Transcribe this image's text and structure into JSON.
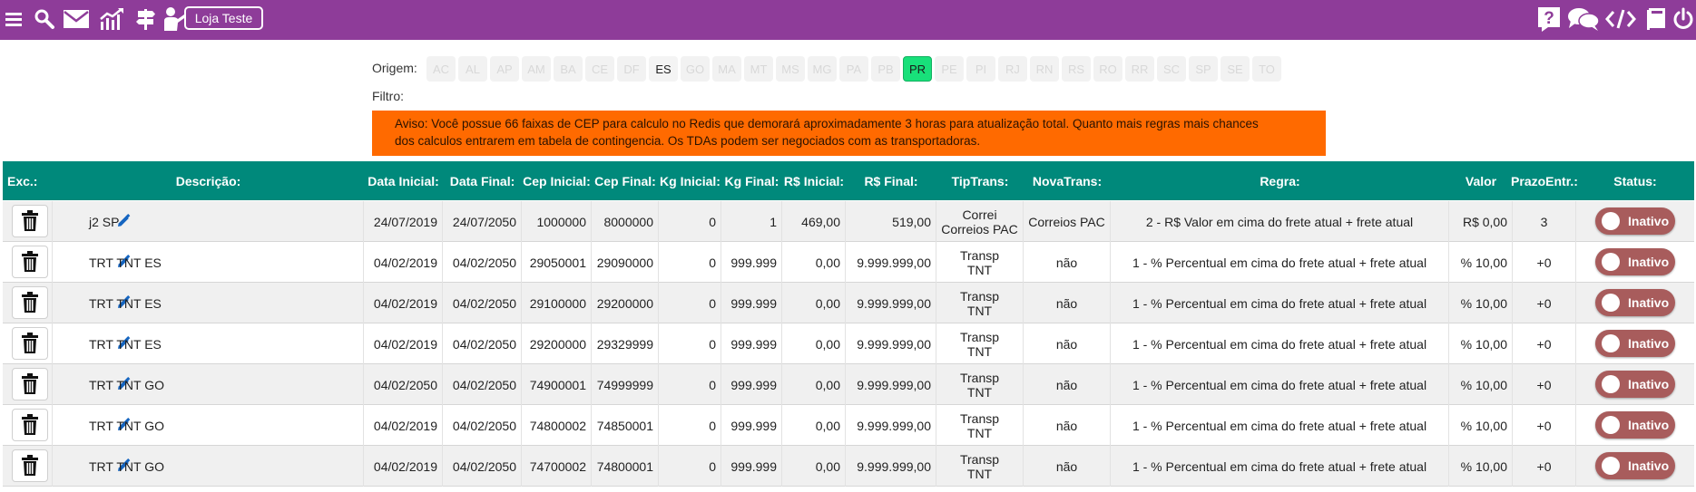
{
  "topbar": {
    "store_button": "Loja Teste",
    "icons_left": [
      "menu-icon",
      "search-icon",
      "mail-icon",
      "chart-icon",
      "signpost-icon",
      "user-board-icon"
    ],
    "icons_right": [
      "help-icon",
      "chat-icon",
      "code-icon",
      "book-icon",
      "power-icon"
    ],
    "bg_color": "#8e3c99"
  },
  "origem": {
    "label": "Origem:",
    "states": [
      {
        "code": "AC",
        "state": "disabled"
      },
      {
        "code": "AL",
        "state": "disabled"
      },
      {
        "code": "AP",
        "state": "disabled"
      },
      {
        "code": "AM",
        "state": "disabled"
      },
      {
        "code": "BA",
        "state": "disabled"
      },
      {
        "code": "CE",
        "state": "disabled"
      },
      {
        "code": "DF",
        "state": "disabled"
      },
      {
        "code": "ES",
        "state": "enabled"
      },
      {
        "code": "GO",
        "state": "disabled"
      },
      {
        "code": "MA",
        "state": "disabled"
      },
      {
        "code": "MT",
        "state": "disabled"
      },
      {
        "code": "MS",
        "state": "disabled"
      },
      {
        "code": "MG",
        "state": "disabled"
      },
      {
        "code": "PA",
        "state": "disabled"
      },
      {
        "code": "PB",
        "state": "disabled"
      },
      {
        "code": "PR",
        "state": "selected"
      },
      {
        "code": "PE",
        "state": "disabled"
      },
      {
        "code": "PI",
        "state": "disabled"
      },
      {
        "code": "RJ",
        "state": "disabled"
      },
      {
        "code": "RN",
        "state": "disabled"
      },
      {
        "code": "RS",
        "state": "disabled"
      },
      {
        "code": "RO",
        "state": "disabled"
      },
      {
        "code": "RR",
        "state": "disabled"
      },
      {
        "code": "SC",
        "state": "disabled"
      },
      {
        "code": "SP",
        "state": "disabled"
      },
      {
        "code": "SE",
        "state": "disabled"
      },
      {
        "code": "TO",
        "state": "disabled"
      }
    ]
  },
  "filtro": {
    "label": "Filtro:"
  },
  "warning": {
    "line1": "Aviso: Você possue 66 faixas de CEP para calculo no Redis que demorará aproximadamente 3 horas para atualização total. Quanto mais regras mais chances",
    "line2": "dos calculos entrarem em tabela de contingencia. Os TDAs podem ser negociados com as transportadoras.",
    "color": "#ff6a00"
  },
  "table": {
    "header_color": "#00897b",
    "headers": {
      "exc": "Exc.:",
      "descricao": "Descrição:",
      "data_inicial": "Data Inicial:",
      "data_final": "Data Final:",
      "cep_inicial": "Cep Inicial:",
      "cep_final": "Cep Final:",
      "kg_inicial": "Kg Inicial:",
      "kg_final": "Kg Final:",
      "rs_inicial": "R$ Inicial:",
      "rs_final": "R$ Final:",
      "tiptrans": "TipTrans:",
      "novatrans": "NovaTrans:",
      "regra": "Regra:",
      "valor": "Valor",
      "prazo": "PrazoEntr.:",
      "status": "Status:"
    },
    "rows": [
      {
        "descricao": "j2 SP",
        "data_inicial": "24/07/2019",
        "data_final": "24/07/2050",
        "cep_inicial": "1000000",
        "cep_final": "8000000",
        "kg_inicial": "0",
        "kg_final": "1",
        "rs_inicial": "469,00",
        "rs_final": "519,00",
        "tiptrans_1": "Correi",
        "tiptrans_2": "Correios PAC",
        "novatrans": "Correios PAC",
        "regra": "2 - R$ Valor em cima do frete atual + frete atual",
        "valor": "R$ 0,00",
        "prazo": "3",
        "status": "Inativo"
      },
      {
        "descricao": "TRT TNT ES",
        "data_inicial": "04/02/2019",
        "data_final": "04/02/2050",
        "cep_inicial": "29050001",
        "cep_final": "29090000",
        "kg_inicial": "0",
        "kg_final": "999.999",
        "rs_inicial": "0,00",
        "rs_final": "9.999.999,00",
        "tiptrans_1": "Transp",
        "tiptrans_2": "TNT",
        "novatrans": "não",
        "regra": "1 - % Percentual em cima do frete atual + frete atual",
        "valor": "% 10,00",
        "prazo": "+0",
        "status": "Inativo"
      },
      {
        "descricao": "TRT TNT ES",
        "data_inicial": "04/02/2019",
        "data_final": "04/02/2050",
        "cep_inicial": "29100000",
        "cep_final": "29200000",
        "kg_inicial": "0",
        "kg_final": "999.999",
        "rs_inicial": "0,00",
        "rs_final": "9.999.999,00",
        "tiptrans_1": "Transp",
        "tiptrans_2": "TNT",
        "novatrans": "não",
        "regra": "1 - % Percentual em cima do frete atual + frete atual",
        "valor": "% 10,00",
        "prazo": "+0",
        "status": "Inativo"
      },
      {
        "descricao": "TRT TNT ES",
        "data_inicial": "04/02/2019",
        "data_final": "04/02/2050",
        "cep_inicial": "29200000",
        "cep_final": "29329999",
        "kg_inicial": "0",
        "kg_final": "999.999",
        "rs_inicial": "0,00",
        "rs_final": "9.999.999,00",
        "tiptrans_1": "Transp",
        "tiptrans_2": "TNT",
        "novatrans": "não",
        "regra": "1 - % Percentual em cima do frete atual + frete atual",
        "valor": "% 10,00",
        "prazo": "+0",
        "status": "Inativo"
      },
      {
        "descricao": "TRT TNT GO",
        "data_inicial": "04/02/2050",
        "data_final": "04/02/2050",
        "cep_inicial": "74900001",
        "cep_final": "74999999",
        "kg_inicial": "0",
        "kg_final": "999.999",
        "rs_inicial": "0,00",
        "rs_final": "9.999.999,00",
        "tiptrans_1": "Transp",
        "tiptrans_2": "TNT",
        "novatrans": "não",
        "regra": "1 - % Percentual em cima do frete atual + frete atual",
        "valor": "% 10,00",
        "prazo": "+0",
        "status": "Inativo"
      },
      {
        "descricao": "TRT TNT GO",
        "data_inicial": "04/02/2019",
        "data_final": "04/02/2050",
        "cep_inicial": "74800002",
        "cep_final": "74850001",
        "kg_inicial": "0",
        "kg_final": "999.999",
        "rs_inicial": "0,00",
        "rs_final": "9.999.999,00",
        "tiptrans_1": "Transp",
        "tiptrans_2": "TNT",
        "novatrans": "não",
        "regra": "1 - % Percentual em cima do frete atual + frete atual",
        "valor": "% 10,00",
        "prazo": "+0",
        "status": "Inativo"
      },
      {
        "descricao": "TRT TNT GO",
        "data_inicial": "04/02/2019",
        "data_final": "04/02/2050",
        "cep_inicial": "74700002",
        "cep_final": "74800001",
        "kg_inicial": "0",
        "kg_final": "999.999",
        "rs_inicial": "0,00",
        "rs_final": "9.999.999,00",
        "tiptrans_1": "Transp",
        "tiptrans_2": "TNT",
        "novatrans": "não",
        "regra": "1 - % Percentual em cima do frete atual + frete atual",
        "valor": "% 10,00",
        "prazo": "+0",
        "status": "Inativo"
      }
    ]
  }
}
